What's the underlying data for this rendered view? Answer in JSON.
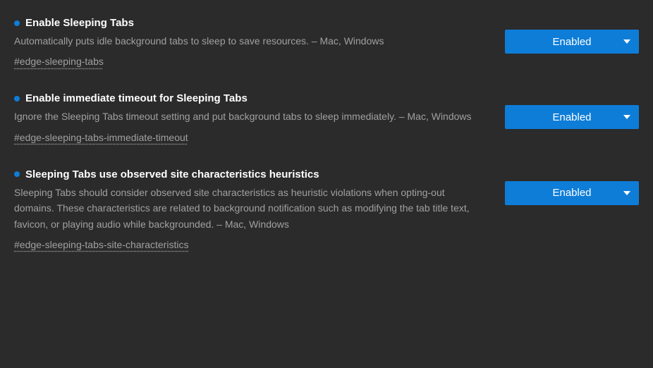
{
  "flags": [
    {
      "title": "Enable Sleeping Tabs",
      "description": "Automatically puts idle background tabs to sleep to save resources. – Mac, Windows",
      "anchor": "#edge-sleeping-tabs",
      "selected": "Enabled"
    },
    {
      "title": "Enable immediate timeout for Sleeping Tabs",
      "description": "Ignore the Sleeping Tabs timeout setting and put background tabs to sleep immediately. – Mac, Windows",
      "anchor": "#edge-sleeping-tabs-immediate-timeout",
      "selected": "Enabled"
    },
    {
      "title": "Sleeping Tabs use observed site characteristics heuristics",
      "description": "Sleeping Tabs should consider observed site characteristics as heuristic violations when opting-out domains. These characteristics are related to background notification such as modifying the tab title text, favicon, or playing audio while backgrounded. – Mac, Windows",
      "anchor": "#edge-sleeping-tabs-site-characteristics",
      "selected": "Enabled"
    }
  ],
  "colors": {
    "accent": "#0e7dd8",
    "background": "#2b2b2b"
  }
}
